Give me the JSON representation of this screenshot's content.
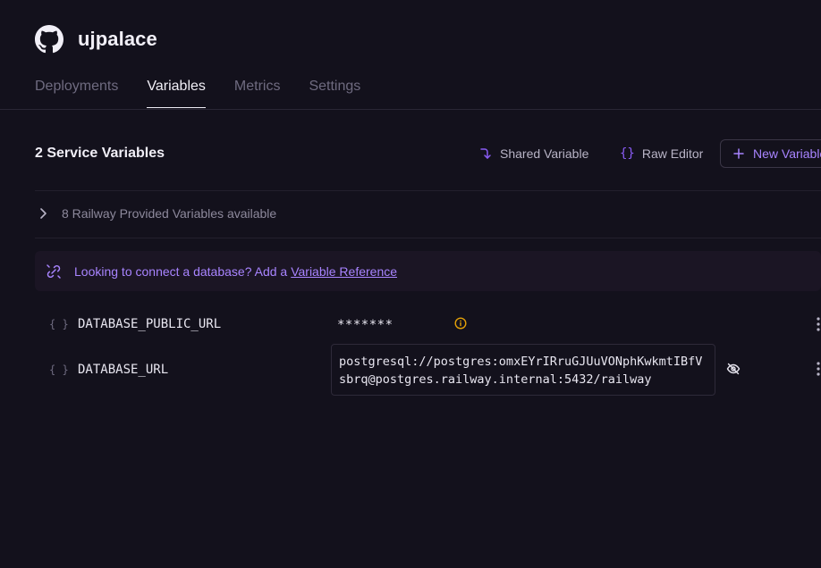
{
  "header": {
    "project_name": "ujpalace",
    "icon": "github-icon"
  },
  "tabs": [
    {
      "label": "Deployments",
      "active": false
    },
    {
      "label": "Variables",
      "active": true
    },
    {
      "label": "Metrics",
      "active": false
    },
    {
      "label": "Settings",
      "active": false
    }
  ],
  "toolbar": {
    "title": "2 Service Variables",
    "shared_label": "Shared Variable",
    "raw_label": "Raw Editor",
    "new_label": "New Variable"
  },
  "provided": {
    "label": "8 Railway Provided Variables available"
  },
  "banner": {
    "text": "Looking to connect a database? Add a",
    "link": "Variable Reference"
  },
  "variables": [
    {
      "brace": "{ }",
      "name": "DATABASE_PUBLIC_URL",
      "value": "*******",
      "revealed": false
    },
    {
      "brace": "{ }",
      "name": "DATABASE_URL",
      "value": "postgresql://postgres:omxEYrIRruGJUuVONphKwkmtIBfVsbrq@postgres.railway.internal:5432/railway",
      "revealed": true
    }
  ],
  "colors": {
    "accent": "#a884ff",
    "background": "#13111c",
    "warning": "#e3a008"
  }
}
